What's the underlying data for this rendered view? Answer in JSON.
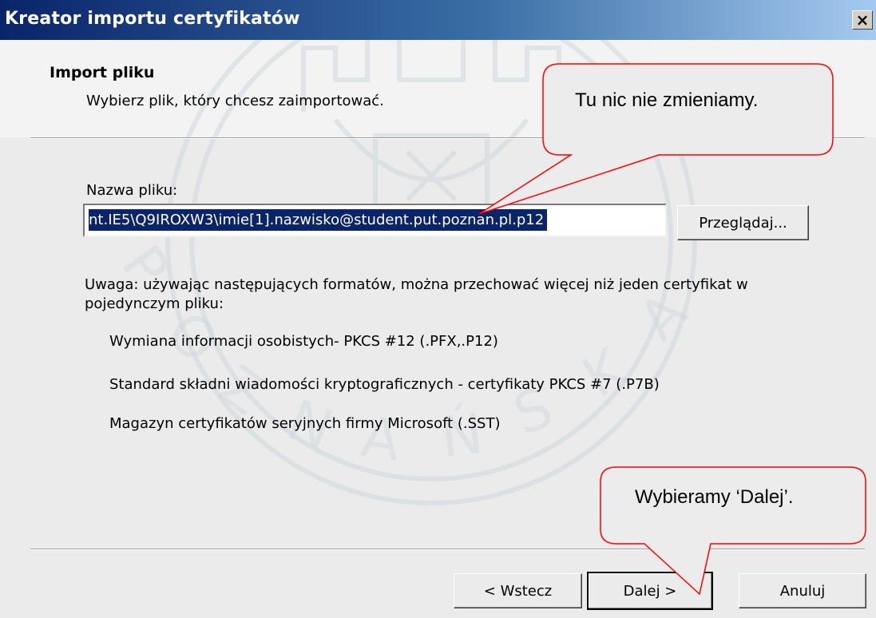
{
  "window": {
    "title": "Kreator importu certyfikatów",
    "close_glyph": "×"
  },
  "header": {
    "title": "Import pliku",
    "subtitle": "Wybierz plik, który chcesz zaimportować."
  },
  "form": {
    "filename_label": "Nazwa pliku:",
    "filename_value": "nt.IE5\\Q9IROXW3\\imie[1].nazwisko@student.put.poznan.pl.p12",
    "browse_label": "Przeglądaj..."
  },
  "note": {
    "text": "Uwaga: używając następujących formatów, można przechować więcej niż jeden certyfikat w pojedynczym pliku:",
    "formats": [
      "Wymiana informacji osobistych- PKCS #12 (.PFX,.P12)",
      "Standard składni wiadomości kryptograficznych - certyfikaty PKCS #7 (.P7B)",
      "Magazyn certyfikatów seryjnych firmy Microsoft (.SST)"
    ]
  },
  "buttons": {
    "back": "< Wstecz",
    "next": "Dalej >",
    "cancel": "Anuluj"
  },
  "callouts": {
    "top": "Tu nic nie zmieniamy.",
    "bottom": "Wybieramy ‘Dalej’."
  },
  "colors": {
    "callout_fill": "#ececec",
    "callout_stroke": "#ff0000",
    "selection": "#0a246a"
  }
}
